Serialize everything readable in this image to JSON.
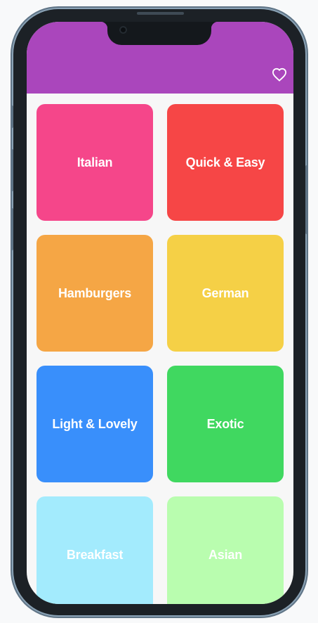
{
  "appbar": {
    "color": "#aa46bc",
    "favorite_icon": "heart-outline-icon"
  },
  "categories": [
    {
      "label": "Italian",
      "color": "#f5468a"
    },
    {
      "label": "Quick & Easy",
      "color": "#f64646"
    },
    {
      "label": "Hamburgers",
      "color": "#f5a645"
    },
    {
      "label": "German",
      "color": "#f5d046"
    },
    {
      "label": "Light & Lovely",
      "color": "#398ffb"
    },
    {
      "label": "Exotic",
      "color": "#40d860"
    },
    {
      "label": "Breakfast",
      "color": "#a3ebfd"
    },
    {
      "label": "Asian",
      "color": "#b9fdaf"
    }
  ]
}
